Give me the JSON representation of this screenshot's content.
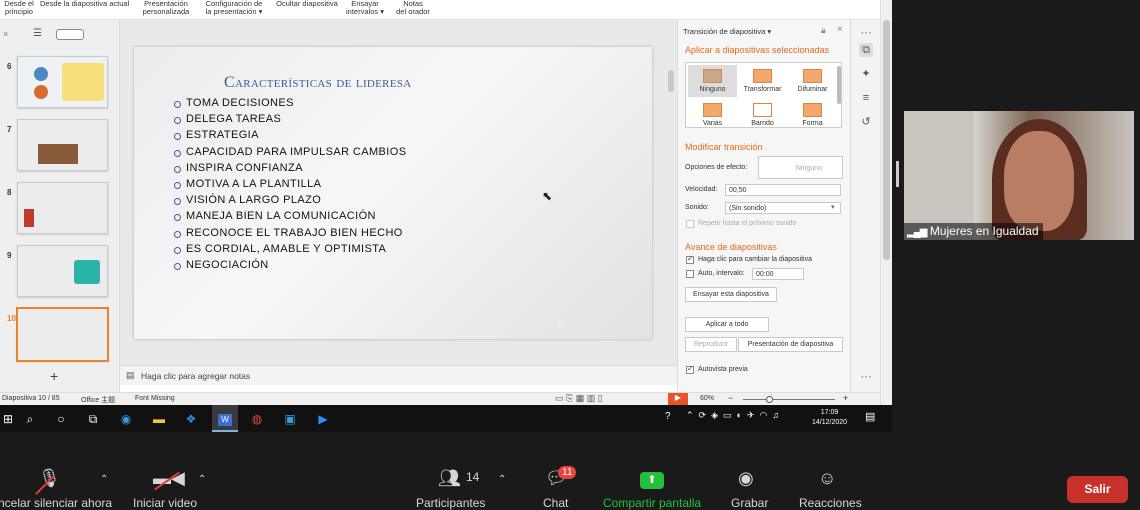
{
  "ribbon": {
    "items": [
      "Desde el\nprincipio",
      "Desde la diapositiva actual",
      "Presentación\npersonalizada",
      "Configuración de\nla presentación ▾",
      "Ocultar diapositiva",
      "Ensayar\nintervalos ▾",
      "Notas\ndel orador"
    ]
  },
  "thumbs": [
    {
      "num": "6"
    },
    {
      "num": "7"
    },
    {
      "num": "8"
    },
    {
      "num": "9"
    },
    {
      "num": "10"
    }
  ],
  "slide": {
    "title": "Características de lideresa",
    "bullets": [
      "TOMA DECISIONES",
      "DELEGA TAREAS",
      "ESTRATEGIA",
      "CAPACIDAD PARA IMPULSAR CAMBIOS",
      "INSPIRA CONFIANZA",
      "MOTIVA A LA PLANTILLA",
      "VISIÓN A LARGO PLAZO",
      "MANEJA BIEN LA COMUNICACIÓN",
      "RECONOCE EL TRABAJO BIEN HECHO",
      "ES CORDIAL, AMABLE Y OPTIMISTA",
      "NEGOCIACIÓN"
    ],
    "page_number": "10"
  },
  "notes_placeholder": "Haga clic para agregar notas",
  "panel": {
    "title": "Transición de diapositiva ▾",
    "apply_header": "Aplicar a diapositivas seleccionadas",
    "transitions": [
      "Ninguno",
      "Transformar",
      "Difuminar",
      "Varias",
      "Barrido",
      "Forma"
    ],
    "modify_header": "Modificar transición",
    "effect_label": "Opciones de efecto:",
    "effect_value": "Ninguno",
    "speed_label": "Velocidad:",
    "speed_value": "00,50",
    "sound_label": "Sonido:",
    "sound_value": "(Sin sonido)",
    "repeat_label": "Repetir hasta el próximo sonido",
    "advance_header": "Avance de diapositivas",
    "click_label": "Haga clic para cambiar la diapositiva",
    "auto_label": "Auto, intervalo:",
    "auto_value": "00:00",
    "rehearse_btn": "Ensayar esta diapositiva",
    "apply_all_btn": "Aplicar a todo",
    "play_btn": "Reproducir",
    "present_btn": "Presentación de diapositiva",
    "autopreview_label": "Autovista previa"
  },
  "status": {
    "slide_info": "Diapositiva  10 / 85",
    "theme": "Office 主题",
    "font_missing": "Font Missing",
    "zoom": "60%"
  },
  "taskbar": {
    "time": "17:09",
    "date": "14/12/2020"
  },
  "video": {
    "participant_name": "Mujeres en Igualdad"
  },
  "controls": {
    "mute_label": "ncelar silenciar ahora",
    "video_label": "Iniciar video",
    "participants_label": "Participantes",
    "participants_count": "14",
    "chat_label": "Chat",
    "chat_badge": "11",
    "share_label": "Compartir pantalla",
    "record_label": "Grabar",
    "reactions_label": "Reacciones",
    "leave_label": "Salir"
  }
}
